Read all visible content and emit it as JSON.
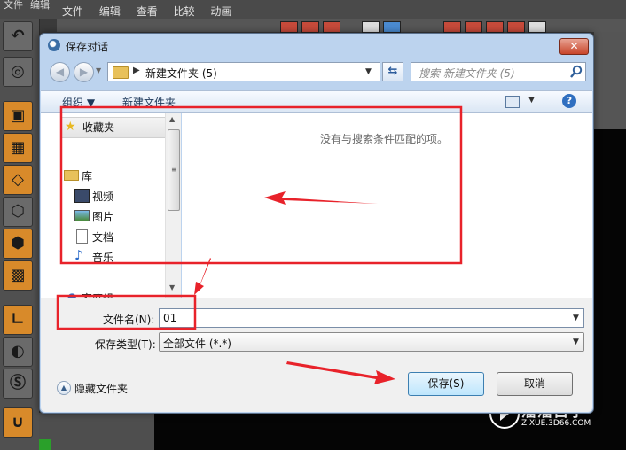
{
  "app": {
    "menu_left": [
      "文件",
      "编辑"
    ],
    "menu": [
      "文件",
      "编辑",
      "查看",
      "比较",
      "动画"
    ]
  },
  "dialog": {
    "title": "保存对话",
    "close_label": "✕",
    "address_path": "新建文件夹 (5)",
    "search_placeholder": "搜索 新建文件夹 (5)",
    "toolbar": {
      "organize": "组织 ▼",
      "new_folder": "新建文件夹"
    },
    "nav": {
      "favorites": "收藏夹",
      "libraries": "库",
      "videos": "视频",
      "pictures": "图片",
      "documents": "文档",
      "music": "音乐",
      "homegroup": "家庭组"
    },
    "empty_message": "没有与搜索条件匹配的项。",
    "filename_label": "文件名(N):",
    "filename_value": "01",
    "filetype_label": "保存类型(T):",
    "filetype_value": "全部文件 (*.*)",
    "hide_folders": "隐藏文件夹",
    "save_button": "保存(S)",
    "cancel_button": "取消"
  },
  "watermark": {
    "title": "溜溜自学",
    "url": "ZIXUE.3D66.COM"
  },
  "colors": {
    "annotation_red": "#e8222a",
    "dialog_frame": "#bcd3ee",
    "primary_button": "#bee6fd"
  }
}
